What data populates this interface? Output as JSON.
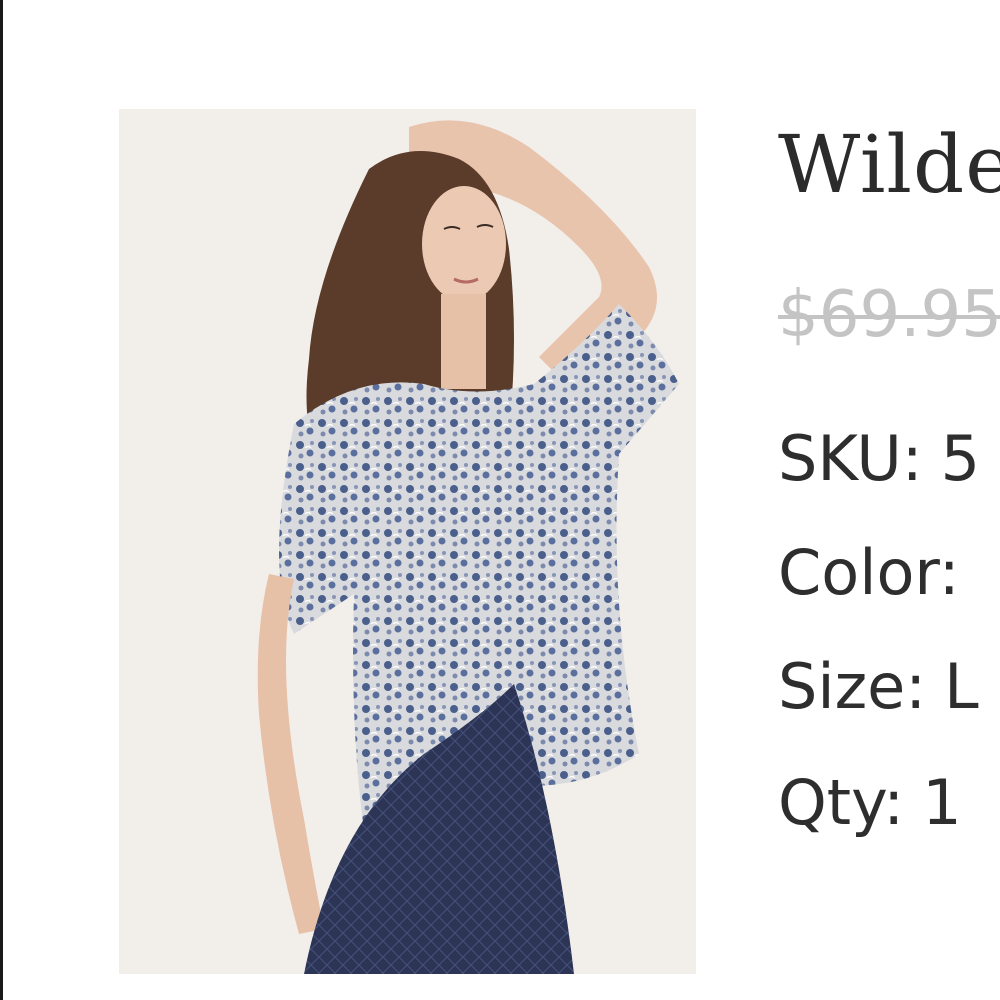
{
  "product": {
    "title": "Wilde",
    "price": "$69.95",
    "details": {
      "sku_label": "SKU:",
      "sku_value": "5",
      "color_label": "Color:",
      "color_value": "",
      "size_label": "Size:",
      "size_value": "L",
      "qty_label": "Qty:",
      "qty_value": "1"
    },
    "image": {
      "description_icon": "product-photo-model-floral-top"
    }
  },
  "colors": {
    "title_text": "#2b2b2b",
    "price_strike": "#c4c4c4",
    "detail_text": "#2e2e2e",
    "photo_background": "#f2eeea",
    "top_print_blue": "#4a5f8c",
    "jeans_navy": "#2c3556"
  }
}
